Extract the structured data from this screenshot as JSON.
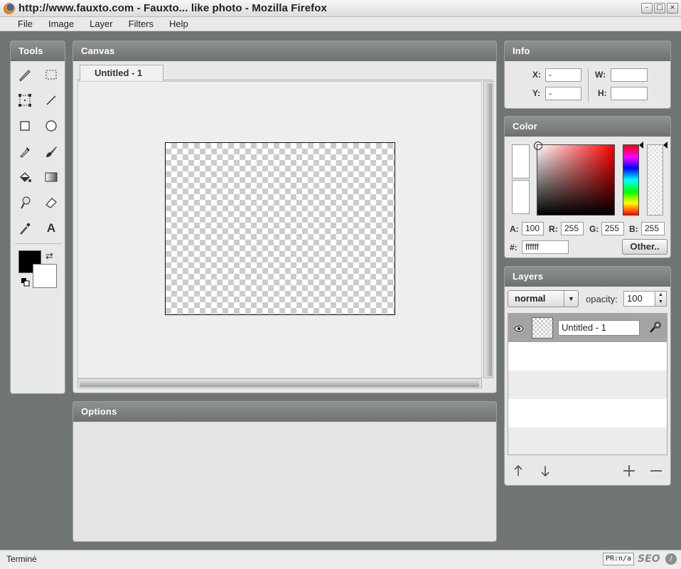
{
  "window": {
    "title": "http://www.fauxto.com - Fauxto... like photo - Mozilla Firefox",
    "min": "–",
    "max": "□",
    "close": "×"
  },
  "menu": [
    "File",
    "Image",
    "Layer",
    "Filters",
    "Help"
  ],
  "tools_panel": {
    "title": "Tools",
    "tools": [
      "pencil-icon",
      "rect-select-icon",
      "crop-icon",
      "line-icon",
      "rectangle-icon",
      "ellipse-icon",
      "eyedropper-icon",
      "brush-icon",
      "paint-bucket-icon",
      "gradient-icon",
      "smudge-icon",
      "eraser-icon",
      "color-picker-icon",
      "text-icon"
    ],
    "text_tool_glyph": "A",
    "swap_glyph": "⇄",
    "foreground": "#000000",
    "background": "#ffffff"
  },
  "canvas_panel": {
    "title": "Canvas",
    "tab": "Untitled - 1"
  },
  "options_panel": {
    "title": "Options"
  },
  "info_panel": {
    "title": "Info",
    "x_label": "X:",
    "x_value": "-",
    "y_label": "Y:",
    "y_value": "-",
    "w_label": "W:",
    "w_value": "",
    "h_label": "H:",
    "h_value": ""
  },
  "color_panel": {
    "title": "Color",
    "a_label": "A:",
    "a": "100",
    "r_label": "R:",
    "r": "255",
    "g_label": "G:",
    "g": "255",
    "b_label": "B:",
    "b": "255",
    "hex_label": "#:",
    "hex": "ffffff",
    "other_button": "Other.."
  },
  "layers_panel": {
    "title": "Layers",
    "blend_mode": "normal",
    "blend_arrow": "▼",
    "opacity_label": "opacity:",
    "opacity": "100",
    "spin_up": "▲",
    "spin_down": "▼",
    "layers": [
      {
        "name": "Untitled - 1",
        "visible": true,
        "selected": true
      }
    ],
    "buttons": [
      "move-up-icon",
      "move-down-icon",
      "add-layer-icon",
      "delete-layer-icon"
    ]
  },
  "status": {
    "text": "Terminé",
    "pr": "PR:n/a",
    "seo": "SEO",
    "stop": "/"
  }
}
